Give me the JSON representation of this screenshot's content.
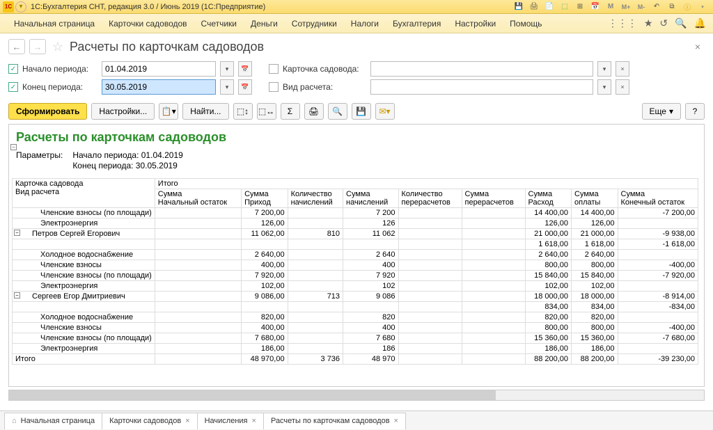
{
  "window": {
    "title": "1С:Бухгалтерия СНТ, редакция 3.0 / Июнь 2019  (1С:Предприятие)"
  },
  "menu": [
    "Начальная страница",
    "Карточки садоводов",
    "Счетчики",
    "Деньги",
    "Сотрудники",
    "Налоги",
    "Бухгалтерия",
    "Настройки",
    "Помощь"
  ],
  "page": {
    "title": "Расчеты по карточкам садоводов"
  },
  "filters": {
    "start_label": "Начало периода:",
    "start_value": "01.04.2019",
    "end_label": "Конец периода:",
    "end_value": "30.05.2019",
    "card_label": "Карточка садовода:",
    "card_value": "",
    "type_label": "Вид расчета:",
    "type_value": ""
  },
  "toolbar": {
    "form": "Сформировать",
    "settings": "Настройки...",
    "find": "Найти...",
    "more": "Еще",
    "help": "?"
  },
  "report": {
    "title": "Расчеты по карточкам садоводов",
    "params_label": "Параметры:",
    "params_lines": [
      "Начало периода: 01.04.2019",
      "Конец периода: 30.05.2019"
    ],
    "col1_a": "Карточка садовода",
    "col1_b": "Вид расчета",
    "col_group": "Итого",
    "cols": [
      "Сумма Начальный остаток",
      "Сумма Приход",
      "Количество начислений",
      "Сумма начислений",
      "Количество перерасчетов",
      "Сумма перерасчетов",
      "Сумма Расход",
      "Сумма оплаты",
      "Сумма Конечный остаток"
    ],
    "rows": [
      {
        "lvl": 2,
        "label": "Членские взносы (по площади)",
        "v": [
          "",
          "7 200,00",
          "",
          "7 200",
          "",
          "",
          "14 400,00",
          "14 400,00",
          "-7 200,00"
        ]
      },
      {
        "lvl": 2,
        "label": "Электроэнергия",
        "v": [
          "",
          "126,00",
          "",
          "126",
          "",
          "",
          "126,00",
          "126,00",
          ""
        ]
      },
      {
        "lvl": 1,
        "expand": true,
        "label": "Петров Сергей Егорович",
        "v": [
          "",
          "11 062,00",
          "810",
          "11 062",
          "",
          "",
          "21 000,00",
          "21 000,00",
          "-9 938,00"
        ]
      },
      {
        "lvl": 1,
        "label": "",
        "v": [
          "",
          "",
          "",
          "",
          "",
          "",
          "1 618,00",
          "1 618,00",
          "-1 618,00"
        ]
      },
      {
        "lvl": 2,
        "label": "Холодное водоснабжение",
        "v": [
          "",
          "2 640,00",
          "",
          "2 640",
          "",
          "",
          "2 640,00",
          "2 640,00",
          ""
        ]
      },
      {
        "lvl": 2,
        "label": "Членские взносы",
        "v": [
          "",
          "400,00",
          "",
          "400",
          "",
          "",
          "800,00",
          "800,00",
          "-400,00"
        ]
      },
      {
        "lvl": 2,
        "label": "Членские взносы (по площади)",
        "v": [
          "",
          "7 920,00",
          "",
          "7 920",
          "",
          "",
          "15 840,00",
          "15 840,00",
          "-7 920,00"
        ]
      },
      {
        "lvl": 2,
        "label": "Электроэнергия",
        "v": [
          "",
          "102,00",
          "",
          "102",
          "",
          "",
          "102,00",
          "102,00",
          ""
        ]
      },
      {
        "lvl": 1,
        "expand": true,
        "label": "Сергеев Егор Дмитриевич",
        "v": [
          "",
          "9 086,00",
          "713",
          "9 086",
          "",
          "",
          "18 000,00",
          "18 000,00",
          "-8 914,00"
        ]
      },
      {
        "lvl": 1,
        "label": "",
        "v": [
          "",
          "",
          "",
          "",
          "",
          "",
          "834,00",
          "834,00",
          "-834,00"
        ]
      },
      {
        "lvl": 2,
        "label": "Холодное водоснабжение",
        "v": [
          "",
          "820,00",
          "",
          "820",
          "",
          "",
          "820,00",
          "820,00",
          ""
        ]
      },
      {
        "lvl": 2,
        "label": "Членские взносы",
        "v": [
          "",
          "400,00",
          "",
          "400",
          "",
          "",
          "800,00",
          "800,00",
          "-400,00"
        ]
      },
      {
        "lvl": 2,
        "label": "Членские взносы (по площади)",
        "v": [
          "",
          "7 680,00",
          "",
          "7 680",
          "",
          "",
          "15 360,00",
          "15 360,00",
          "-7 680,00"
        ]
      },
      {
        "lvl": 2,
        "label": "Электроэнергия",
        "v": [
          "",
          "186,00",
          "",
          "186",
          "",
          "",
          "186,00",
          "186,00",
          ""
        ]
      }
    ],
    "total_label": "Итого",
    "total": [
      "",
      "48 970,00",
      "3 736",
      "48 970",
      "",
      "",
      "88 200,00",
      "88 200,00",
      "-39 230,00"
    ]
  },
  "tabs": [
    "Начальная страница",
    "Карточки садоводов",
    "Начисления",
    "Расчеты по карточкам садоводов"
  ]
}
